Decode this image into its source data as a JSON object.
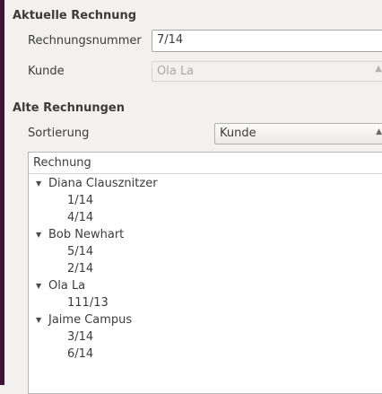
{
  "current": {
    "section_title": "Aktuelle Rechnung",
    "invoice_number_label": "Rechnungsnummer",
    "invoice_number_value": "7/14",
    "customer_label": "Kunde",
    "customer_value": "Ola La"
  },
  "old": {
    "section_title": "Alte Rechnungen",
    "sort_label": "Sortierung",
    "sort_value": "Kunde",
    "tree_header": "Rechnung",
    "groups": [
      {
        "customer": "Diana Clausznitzer",
        "invoices": [
          "1/14",
          "4/14"
        ]
      },
      {
        "customer": "Bob Newhart",
        "invoices": [
          "5/14",
          "2/14"
        ]
      },
      {
        "customer": "Ola La",
        "invoices": [
          "111/13"
        ]
      },
      {
        "customer": "Jaime Campus",
        "invoices": [
          "3/14",
          "6/14"
        ]
      }
    ]
  },
  "icons": {
    "expanded": "triangle-down-icon",
    "combo_arrow": "chevron-updown-icon"
  },
  "colors": {
    "window_bg": "#f2f1f0",
    "left_border": "#3b1533",
    "text": "#3c3c3c",
    "disabled_text": "#a9a8a6"
  }
}
